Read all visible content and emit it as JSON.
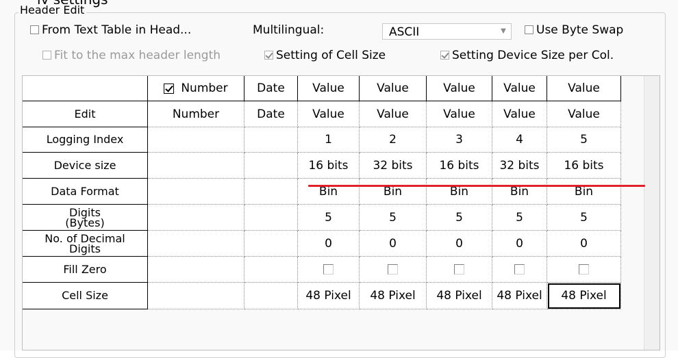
{
  "top_text": "ly settings",
  "group": {
    "legend": "Header Edit",
    "from_text_table": {
      "label": "From Text Table in Head...",
      "checked": false
    },
    "multilingual_label": "Multilingual:",
    "multilingual_value": "ASCII",
    "use_byte_swap": {
      "label": "Use Byte Swap",
      "checked": false
    },
    "fit_max_header": {
      "label": "Fit to the max header length",
      "checked": false,
      "enabled": false
    },
    "setting_cell_size": {
      "label": "Setting of Cell Size",
      "checked": true,
      "enabled": false
    },
    "setting_device_size": {
      "label": "Setting Device Size per Col.",
      "checked": true,
      "enabled": false
    }
  },
  "table": {
    "header": {
      "number": "Number",
      "number_checked": true,
      "date": "Date",
      "values": [
        "Value",
        "Value",
        "Value",
        "Value",
        "Value"
      ]
    },
    "rows": [
      {
        "label": "Edit",
        "number": "Number",
        "date": "Date",
        "cells": [
          "Value",
          "Value",
          "Value",
          "Value",
          "Value"
        ]
      },
      {
        "label": "Logging Index",
        "number": "",
        "date": "",
        "cells": [
          "1",
          "2",
          "3",
          "4",
          "5"
        ]
      },
      {
        "label": "Device size",
        "number": "",
        "date": "",
        "cells": [
          "16 bits",
          "32 bits",
          "16 bits",
          "32 bits",
          "16 bits"
        ]
      },
      {
        "label": "Data Format",
        "number": "",
        "date": "",
        "cells": [
          "Bin",
          "Bin",
          "Bin",
          "Bin",
          "Bin"
        ]
      },
      {
        "label": "Digits\n(Bytes)",
        "number": "",
        "date": "",
        "cells": [
          "5",
          "5",
          "5",
          "5",
          "5"
        ]
      },
      {
        "label": "No. of Decimal\nDigits",
        "number": "",
        "date": "",
        "cells": [
          "0",
          "0",
          "0",
          "0",
          "0"
        ]
      },
      {
        "label": "Fill Zero",
        "number": "",
        "date": "",
        "cells": [
          "",
          "",
          "",
          "",
          ""
        ],
        "checkboxes": [
          false,
          false,
          false,
          false,
          false
        ]
      },
      {
        "label": "Cell Size",
        "number": "",
        "date": "",
        "cells": [
          "48 Pixel",
          "48 Pixel",
          "48 Pixel",
          "48 Pixel",
          "48 Pixel"
        ]
      }
    ],
    "selected_cell": "Cell Size / column 5",
    "highlight_color": "#e0202a"
  }
}
